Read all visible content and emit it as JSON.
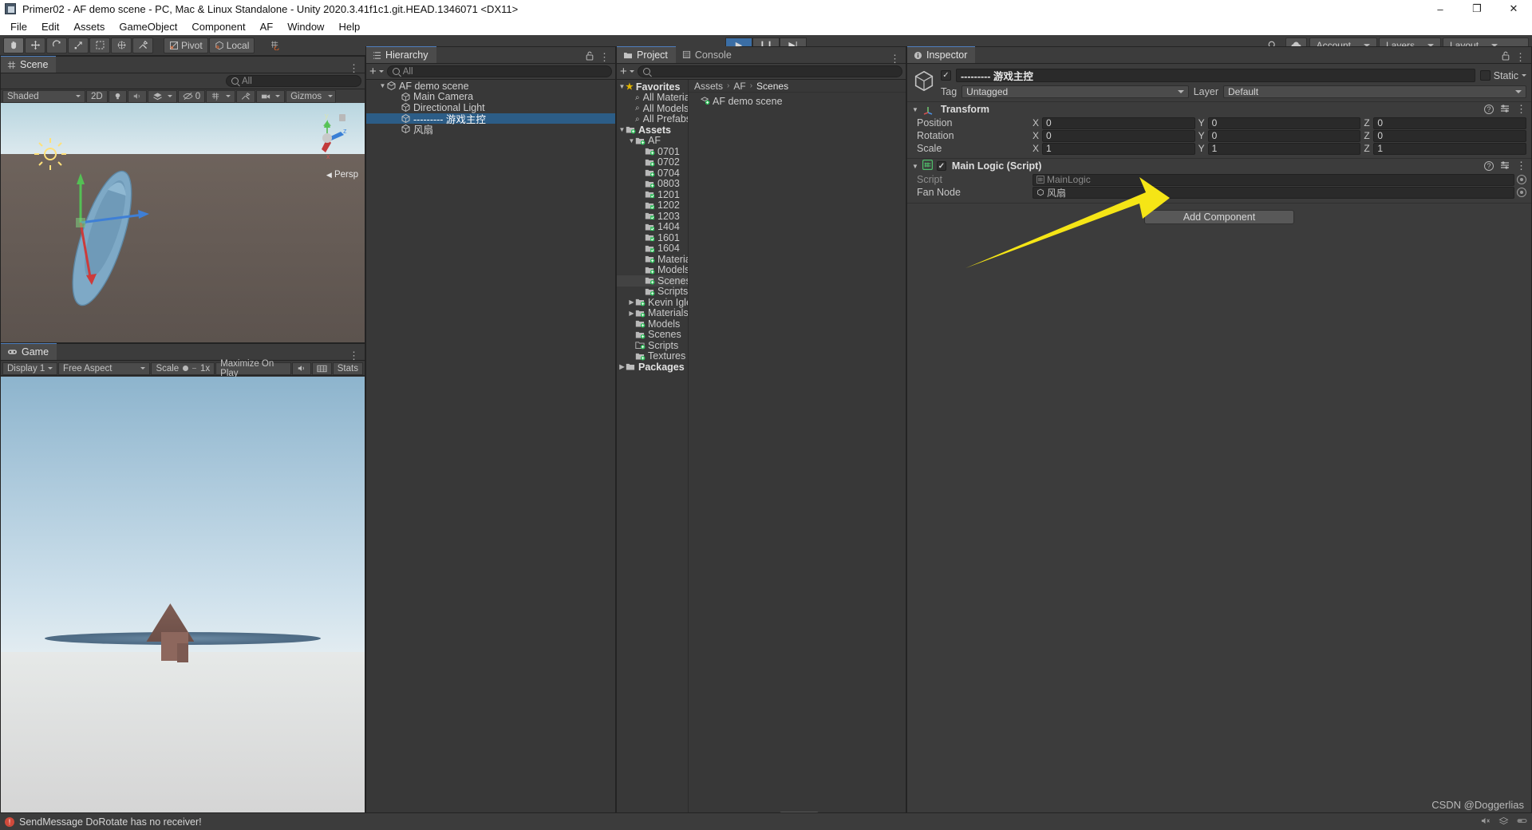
{
  "window": {
    "title": "Primer02 - AF demo scene - PC, Mac & Linux Standalone - Unity 2020.3.41f1c1.git.HEAD.1346071 <DX11>",
    "minimize": "–",
    "maximize": "❐",
    "close": "✕"
  },
  "menu": {
    "items": [
      "File",
      "Edit",
      "Assets",
      "GameObject",
      "Component",
      "AF",
      "Window",
      "Help"
    ]
  },
  "toolbar": {
    "tools": [
      "hand-tool",
      "move-tool",
      "rotate-tool",
      "scale-tool",
      "rect-tool",
      "transform-tool",
      "custom-tool"
    ],
    "pivot_label": "Pivot",
    "local_label": "Local",
    "play": "▶",
    "pause": "❙❙",
    "step": "▶|",
    "cloud": "☁",
    "account_label": "Account",
    "layers_label": "Layers",
    "layout_label": "Layout",
    "search_icon": "search-icon"
  },
  "scene": {
    "tab_label": "Scene",
    "shading_mode": "Shaded",
    "mode_2d": "2D",
    "audio_count": "0",
    "gizmos_label": "Gizmos",
    "search_placeholder": "All",
    "persp_label": "Persp",
    "axis_x": "x",
    "axis_y": "y",
    "axis_z": "z"
  },
  "game": {
    "tab_label": "Game",
    "display": "Display 1",
    "aspect": "Free Aspect",
    "scale_label": "Scale",
    "scale_value": "1x",
    "maximize_label": "Maximize On Play",
    "stats_label": "Stats"
  },
  "hierarchy": {
    "tab_label": "Hierarchy",
    "add_label": "+",
    "search_placeholder": "All",
    "items": [
      {
        "label": "AF demo scene",
        "depth": 0,
        "expanded": true,
        "icon": "scene-icon",
        "selected": false
      },
      {
        "label": "Main Camera",
        "depth": 1,
        "expanded": false,
        "icon": "gameobject-icon",
        "selected": false
      },
      {
        "label": "Directional Light",
        "depth": 1,
        "expanded": false,
        "icon": "gameobject-icon",
        "selected": false
      },
      {
        "label": "--------- 游戏主控",
        "depth": 1,
        "expanded": false,
        "icon": "gameobject-icon",
        "selected": true
      },
      {
        "label": "风扇",
        "depth": 1,
        "expanded": false,
        "icon": "gameobject-icon",
        "selected": false
      }
    ]
  },
  "project": {
    "tab_label": "Project",
    "console_tab_label": "Console",
    "add_label": "+",
    "search_placeholder": "",
    "breadcrumb": [
      "Assets",
      "AF",
      "Scenes"
    ],
    "content_items": [
      {
        "label": "AF demo scene",
        "icon": "unity-scene-icon"
      }
    ],
    "tree": [
      {
        "label": "Favorites",
        "depth": 0,
        "type": "favorites",
        "expanded": true,
        "bold": true
      },
      {
        "label": "All Materia",
        "depth": 1,
        "type": "search",
        "expanded": false,
        "bold": false
      },
      {
        "label": "All Models",
        "depth": 1,
        "type": "search",
        "expanded": false,
        "bold": false
      },
      {
        "label": "All Prefabs",
        "depth": 1,
        "type": "search",
        "expanded": false,
        "bold": false
      },
      {
        "label": "Assets",
        "depth": 0,
        "type": "folder-link",
        "expanded": true,
        "bold": true
      },
      {
        "label": "AF",
        "depth": 1,
        "type": "folder-link",
        "expanded": true,
        "bold": false
      },
      {
        "label": "0701",
        "depth": 2,
        "type": "folder-link",
        "expanded": false,
        "bold": false
      },
      {
        "label": "0702",
        "depth": 2,
        "type": "folder-link",
        "expanded": false,
        "bold": false
      },
      {
        "label": "0704",
        "depth": 2,
        "type": "folder-link",
        "expanded": false,
        "bold": false
      },
      {
        "label": "0803",
        "depth": 2,
        "type": "folder-link",
        "expanded": false,
        "bold": false
      },
      {
        "label": "1201",
        "depth": 2,
        "type": "folder-check",
        "expanded": false,
        "bold": false
      },
      {
        "label": "1202",
        "depth": 2,
        "type": "folder-check",
        "expanded": false,
        "bold": false
      },
      {
        "label": "1203",
        "depth": 2,
        "type": "folder-check",
        "expanded": false,
        "bold": false
      },
      {
        "label": "1404",
        "depth": 2,
        "type": "folder-check",
        "expanded": false,
        "bold": false
      },
      {
        "label": "1601",
        "depth": 2,
        "type": "folder-check",
        "expanded": false,
        "bold": false
      },
      {
        "label": "1604",
        "depth": 2,
        "type": "folder-check",
        "expanded": false,
        "bold": false
      },
      {
        "label": "Material",
        "depth": 2,
        "type": "folder-link",
        "expanded": false,
        "bold": false
      },
      {
        "label": "Models",
        "depth": 2,
        "type": "folder-link",
        "expanded": false,
        "bold": false
      },
      {
        "label": "Scenes",
        "depth": 2,
        "type": "folder-link",
        "expanded": false,
        "bold": false,
        "highlight": true
      },
      {
        "label": "Scripts",
        "depth": 2,
        "type": "folder-link",
        "expanded": false,
        "bold": false
      },
      {
        "label": "Kevin Igles",
        "depth": 1,
        "type": "folder-link",
        "expanded": false,
        "collapsible": true,
        "bold": false
      },
      {
        "label": "Materials",
        "depth": 1,
        "type": "folder-link",
        "expanded": false,
        "collapsible": true,
        "bold": false
      },
      {
        "label": "Models",
        "depth": 1,
        "type": "folder-link",
        "expanded": false,
        "bold": false
      },
      {
        "label": "Scenes",
        "depth": 1,
        "type": "folder-link",
        "expanded": false,
        "bold": false
      },
      {
        "label": "Scripts",
        "depth": 1,
        "type": "folder-open",
        "expanded": false,
        "bold": false
      },
      {
        "label": "Textures",
        "depth": 1,
        "type": "folder-link",
        "expanded": false,
        "bold": false
      },
      {
        "label": "Packages",
        "depth": 0,
        "type": "folder-plain",
        "expanded": false,
        "collapsible": true,
        "bold": true
      }
    ]
  },
  "inspector": {
    "tab_label": "Inspector",
    "object_name": "--------- 游戏主控",
    "enabled": true,
    "static_label": "Static",
    "tag_label": "Tag",
    "tag_value": "Untagged",
    "layer_label": "Layer",
    "layer_value": "Default",
    "components": [
      {
        "title": "Transform",
        "icon": "transform-icon",
        "has_checkbox": false,
        "rows": [
          {
            "name": "Position",
            "x": "0",
            "y": "0",
            "z": "0"
          },
          {
            "name": "Rotation",
            "x": "0",
            "y": "0",
            "z": "0"
          },
          {
            "name": "Scale",
            "x": "1",
            "y": "1",
            "z": "1"
          }
        ]
      }
    ],
    "script_component": {
      "title": "Main Logic (Script)",
      "icon": "cs-script-icon",
      "enabled": true,
      "script_label": "Script",
      "script_value": "MainLogic",
      "fan_node_label": "Fan Node",
      "fan_node_value": "风扇"
    },
    "add_component_label": "Add Component"
  },
  "status": {
    "message": "SendMessage DoRotate has no receiver!",
    "watermark": "CSDN @Doggerlias"
  },
  "annotation": {
    "arrow_color": "#f5e516"
  }
}
